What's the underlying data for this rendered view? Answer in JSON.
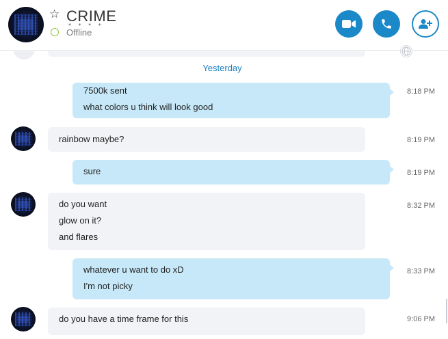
{
  "header": {
    "contact_name": "CRIME",
    "name_decoration": "* * * *",
    "status": "Offline",
    "star_glyph": "☆",
    "colors": {
      "accent": "#1b88c8",
      "status_offline": "#8cc63f"
    }
  },
  "actions": {
    "video": {
      "icon": "video-camera-icon"
    },
    "call": {
      "icon": "phone-icon"
    },
    "add": {
      "icon": "add-contact-icon"
    }
  },
  "chat": {
    "date_separator": "Yesterday",
    "colors": {
      "outgoing": "#c7e8f8",
      "incoming": "#f1f3f6"
    },
    "messages": [
      {
        "from": "me",
        "lines": [
          "7500k sent",
          "what colors u think will look good"
        ],
        "time": "8:18 PM"
      },
      {
        "from": "them",
        "lines": [
          "rainbow maybe?"
        ],
        "time": "8:19 PM"
      },
      {
        "from": "me",
        "lines": [
          "sure"
        ],
        "time": "8:19 PM"
      },
      {
        "from": "them",
        "lines": [
          "do you want",
          "glow on it?",
          "and flares"
        ],
        "time": "8:32 PM"
      },
      {
        "from": "me",
        "lines": [
          "whatever u want to do xD",
          "I'm not picky"
        ],
        "time": "8:33 PM"
      },
      {
        "from": "them",
        "lines": [
          "do you have a time frame for this"
        ],
        "time": "9:06 PM"
      }
    ]
  }
}
